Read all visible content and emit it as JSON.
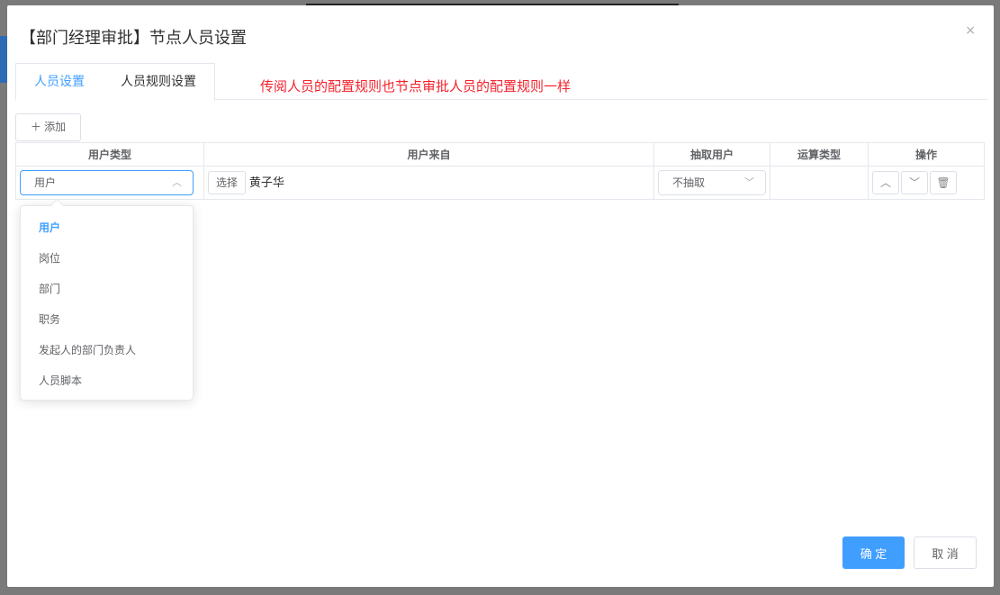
{
  "dialog": {
    "title": "【部门经理审批】节点人员设置",
    "close": "×"
  },
  "tabs": [
    {
      "label": "人员设置"
    },
    {
      "label": "人员规则设置"
    }
  ],
  "note": "传阅人员的配置规则也节点审批人员的配置规则一样",
  "toolbar": {
    "add_label": "＋ 添加"
  },
  "table": {
    "headers": [
      "用户类型",
      "用户来自",
      "抽取用户",
      "运算类型",
      "操作"
    ],
    "row": {
      "user_type": "用户",
      "choose_label": "选择",
      "user_from": "黄子华",
      "extract": "不抽取",
      "op_type": ""
    }
  },
  "dropdown": {
    "options": [
      "用户",
      "岗位",
      "部门",
      "职务",
      "发起人的部门负责人",
      "人员脚本"
    ],
    "selected": "用户"
  },
  "footer": {
    "ok": "确 定",
    "cancel": "取 消"
  },
  "colors": {
    "primary": "#409eff",
    "note": "#f5222d"
  }
}
